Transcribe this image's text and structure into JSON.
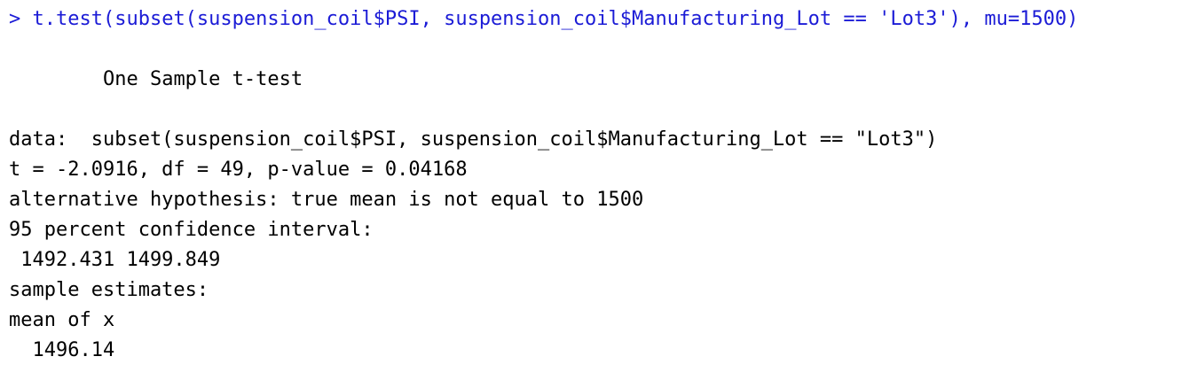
{
  "console": {
    "command": {
      "prompt": ">",
      "text": "t.test(subset(suspension_coil$PSI, suspension_coil$Manufacturing_Lot == 'Lot3'), mu=1500)"
    },
    "output": {
      "test_title": "One Sample t-test",
      "data_line": "data:  subset(suspension_coil$PSI, suspension_coil$Manufacturing_Lot == \"Lot3\")",
      "stats_line": "t = -2.0916, df = 49, p-value = 0.04168",
      "alt_hypothesis": "alternative hypothesis: true mean is not equal to 1500",
      "ci_label": "95 percent confidence interval:",
      "ci_values": " 1492.431 1499.849",
      "estimates_label": "sample estimates:",
      "estimate_name": "mean of x",
      "estimate_value": "  1496.14"
    },
    "colors": {
      "command": "#1b1bd6",
      "output": "#000000",
      "background": "#ffffff"
    }
  }
}
